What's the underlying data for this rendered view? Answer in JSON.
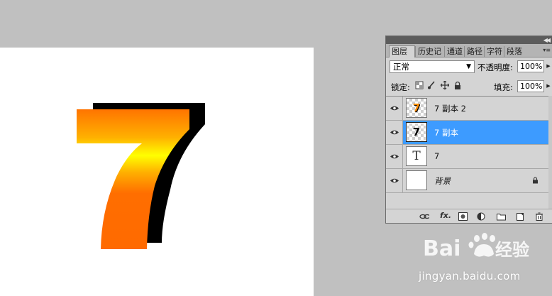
{
  "canvas": {
    "glyph": "7",
    "colors": {
      "gradient_top": "#ff7a00",
      "gradient_mid": "#ffff00",
      "gradient_bottom": "#ff6a00",
      "shadow": "#000000"
    }
  },
  "panel": {
    "tabs": [
      {
        "label": "图层",
        "active": true
      },
      {
        "label": "历史记",
        "active": false
      },
      {
        "label": "通道",
        "active": false
      },
      {
        "label": "路径",
        "active": false
      },
      {
        "label": "字符",
        "active": false
      },
      {
        "label": "段落",
        "active": false
      }
    ],
    "blend_mode": "正常",
    "opacity_label": "不透明度:",
    "opacity_value": "100%",
    "lock_label": "锁定:",
    "fill_label": "填充:",
    "fill_value": "100%",
    "layers": [
      {
        "name": "7 副本 2",
        "thumb": "7",
        "selected": false
      },
      {
        "name": "7 副本",
        "thumb": "7",
        "selected": true
      },
      {
        "name": "7",
        "thumb": "T",
        "selected": false
      },
      {
        "name": "背景",
        "thumb": "",
        "selected": false,
        "locked": true
      }
    ],
    "accent": "#3d9bff"
  },
  "watermark": {
    "brand": "Baidu",
    "suffix": "经验",
    "url": "jingyan.baidu.com"
  }
}
